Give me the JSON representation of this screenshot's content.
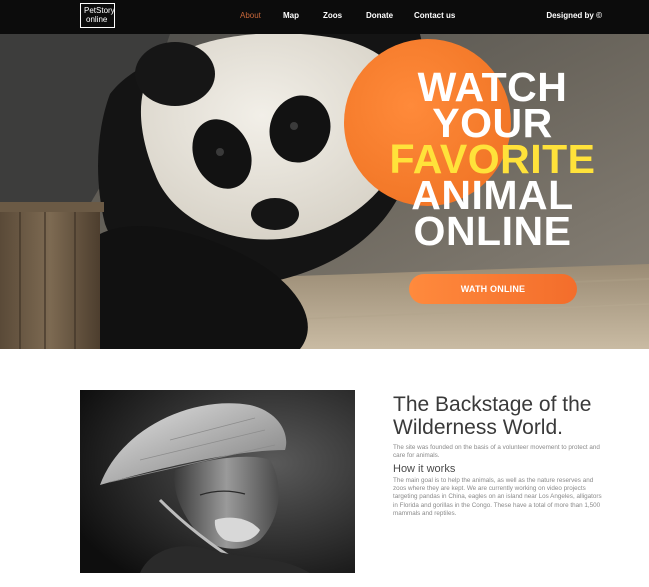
{
  "navbar": {
    "logo": {
      "line1": "PetStory",
      "line2": "online"
    },
    "links": [
      {
        "label": "About",
        "active": true
      },
      {
        "label": "Map",
        "active": false
      },
      {
        "label": "Zoos",
        "active": false
      },
      {
        "label": "Donate",
        "active": false
      },
      {
        "label": "Contact us",
        "active": false
      }
    ],
    "designed_by": "Designed by ©"
  },
  "hero": {
    "headline": [
      "WATCH",
      "YOUR",
      "FAVORITE",
      "ANIMAL",
      "ONLINE"
    ],
    "highlight_word": "FAVORITE",
    "button_label": "WATH ONLINE",
    "colors": {
      "circle": "#f47a2a",
      "highlight": "#ffe23a",
      "button": "#f36d2b"
    }
  },
  "about": {
    "title": "The Backstage of the Wilderness World.",
    "intro": "The site was founded on the basis of a volunteer movement to protect and care for animals.",
    "how_title": "How it works",
    "how_body": "The main goal is to help the animals, as well as the nature reserves and zoos where they are kept. We are currently working on video projects targeting pandas in China, eagles on an island near Los Angeles, alligators in Florida and gorillas in the Congo. These have a total of more than 1,500 mammals and reptiles."
  },
  "colors": {
    "nav_background": "#0c0c0c",
    "nav_active": "#c7673a"
  }
}
